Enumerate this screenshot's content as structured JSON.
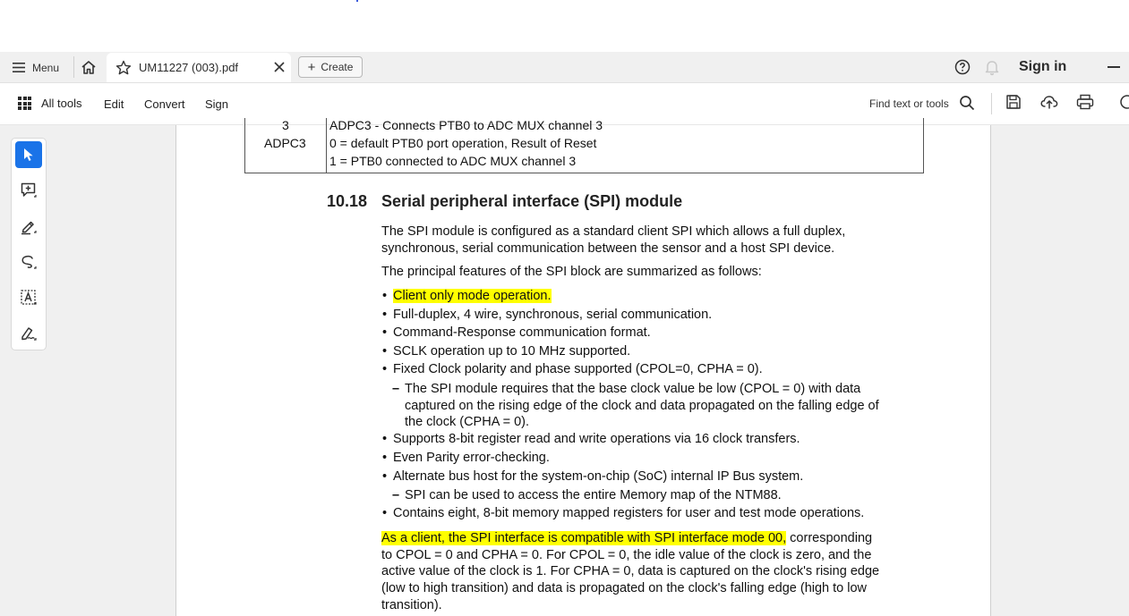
{
  "tabbar": {
    "menu_label": "Menu",
    "doc_tab_title": "UM11227 (003).pdf",
    "create_label": "Create",
    "signin_label": "Sign in"
  },
  "toolbar": {
    "all_tools": "All tools",
    "edit": "Edit",
    "convert": "Convert",
    "sign": "Sign",
    "find_label": "Find text or tools"
  },
  "left_tools": [
    "select-tool",
    "add-comment-tool",
    "highlight-tool",
    "draw-tool",
    "text-select-tool",
    "sign-tool"
  ],
  "document": {
    "register_table": {
      "bit": "3",
      "name": "ADPC3",
      "lines": [
        "ADPC3 - Connects PTB0 to ADC MUX channel 3",
        "0 = default PTB0 port operation, Result of Reset",
        "1 = PTB0 connected to ADC MUX channel 3"
      ]
    },
    "section_number": "10.18",
    "section_title": "Serial peripheral interface (SPI) module",
    "intro_line1": "The SPI module is configured as a standard client SPI which allows a full duplex,",
    "intro_line2": "synchronous, serial communication between the sensor and a host SPI device.",
    "summary": "The principal features of the SPI block are summarized as follows:",
    "bullets": [
      "Client only mode operation.",
      "Full-duplex, 4 wire, synchronous, serial communication.",
      "Command-Response communication format.",
      "SCLK operation up to 10 MHz supported.",
      "Fixed Clock polarity and phase supported (CPOL=0, CPHA = 0).",
      "Supports 8-bit register read and write operations via 16 clock transfers.",
      "Even Parity error-checking.",
      "Alternate bus host for the system-on-chip (SoC) internal IP Bus system.",
      "Contains eight, 8-bit memory mapped registers for user and test mode operations."
    ],
    "sub_bullets": {
      "clock_lines": [
        "The SPI module requires that the base clock value be low (CPOL = 0) with data",
        "captured on the rising edge of the clock and data propagated on the falling edge of",
        "the clock (CPHA = 0)."
      ],
      "memory": "SPI can be used to access the entire Memory map of the NTM88."
    },
    "mode_para": {
      "highlighted": "As a client, the SPI interface is compatible with SPI interface mode 00,",
      "rest_first_line": " corresponding",
      "lines": [
        "to CPOL = 0 and CPHA = 0. For CPOL = 0, the idle value of the clock is zero, and the",
        "active value of the clock is 1. For CPHA = 0, data is captured on the clock's rising edge",
        "(low to high transition) and data is propagated on the clock's falling edge (high to low",
        "transition)."
      ]
    }
  },
  "colors": {
    "highlight": "#ffff00",
    "active_tool": "#1a73e8",
    "workspace_bg": "#f0f0f0"
  }
}
